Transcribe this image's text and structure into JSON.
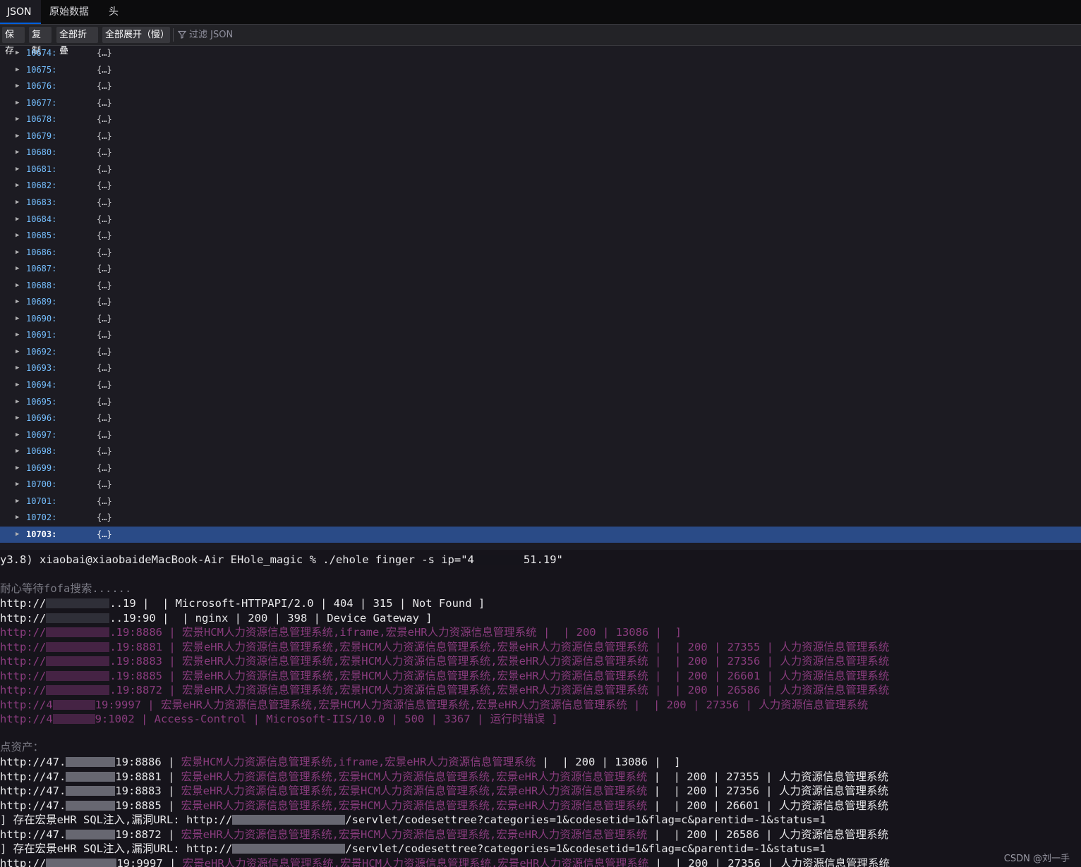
{
  "tabs": [
    {
      "label": "JSON",
      "active": true
    },
    {
      "label": "原始数据",
      "active": false
    },
    {
      "label": "头",
      "active": false
    }
  ],
  "toolbar": {
    "save_label": "保存",
    "copy_label": "复制",
    "collapse_label": "全部折叠",
    "expand_label": "全部展开（慢）",
    "filter_placeholder": "过滤 JSON"
  },
  "json_rows": [
    {
      "key": "10674:",
      "value": "{…}"
    },
    {
      "key": "10675:",
      "value": "{…}"
    },
    {
      "key": "10676:",
      "value": "{…}"
    },
    {
      "key": "10677:",
      "value": "{…}"
    },
    {
      "key": "10678:",
      "value": "{…}"
    },
    {
      "key": "10679:",
      "value": "{…}"
    },
    {
      "key": "10680:",
      "value": "{…}"
    },
    {
      "key": "10681:",
      "value": "{…}"
    },
    {
      "key": "10682:",
      "value": "{…}"
    },
    {
      "key": "10683:",
      "value": "{…}"
    },
    {
      "key": "10684:",
      "value": "{…}"
    },
    {
      "key": "10685:",
      "value": "{…}"
    },
    {
      "key": "10686:",
      "value": "{…}"
    },
    {
      "key": "10687:",
      "value": "{…}"
    },
    {
      "key": "10688:",
      "value": "{…}"
    },
    {
      "key": "10689:",
      "value": "{…}"
    },
    {
      "key": "10690:",
      "value": "{…}"
    },
    {
      "key": "10691:",
      "value": "{…}"
    },
    {
      "key": "10692:",
      "value": "{…}"
    },
    {
      "key": "10693:",
      "value": "{…}"
    },
    {
      "key": "10694:",
      "value": "{…}"
    },
    {
      "key": "10695:",
      "value": "{…}"
    },
    {
      "key": "10696:",
      "value": "{…}"
    },
    {
      "key": "10697:",
      "value": "{…}"
    },
    {
      "key": "10698:",
      "value": "{…}"
    },
    {
      "key": "10699:",
      "value": "{…}"
    },
    {
      "key": "10700:",
      "value": "{…}"
    },
    {
      "key": "10701:",
      "value": "{…}"
    },
    {
      "key": "10702:",
      "value": "{…}"
    },
    {
      "key": "10703:",
      "value": "{…}",
      "selected": true
    }
  ],
  "terminal": {
    "prompt": "y3.8) xiaobai@xiaobaideMacBook-Air EHole_magic % ./ehole finger -s ip=\"4",
    "prompt_end": "51.19\"",
    "wait_msg": "耐心等待fofa搜索......",
    "lines1": [
      {
        "pre": "http://",
        "suf": "..19 |  | Microsoft-HTTPAPI/2.0 | 404 | 315 | Not Found ]",
        "style": "white"
      },
      {
        "pre": "http://",
        "suf": "..19:90 |  | nginx | 200 | 398 | Device Gateway ]",
        "style": "white"
      },
      {
        "pre": "http://",
        "suf": ".19:8886 | 宏景HCM人力资源信息管理系统,iframe,宏景eHR人力资源信息管理系统 |  | 200 | 13086 |  ]",
        "style": "pink"
      },
      {
        "pre": "http://",
        "suf": ".19:8881 | 宏景eHR人力资源信息管理系统,宏景HCM人力资源信息管理系统,宏景eHR人力资源信息管理系统 |  | 200 | 27355 | 人力资源信息管理系统",
        "style": "pink"
      },
      {
        "pre": "http://",
        "suf": ".19:8883 | 宏景eHR人力资源信息管理系统,宏景HCM人力资源信息管理系统,宏景eHR人力资源信息管理系统 |  | 200 | 27356 | 人力资源信息管理系统",
        "style": "pink"
      },
      {
        "pre": "http://",
        "suf": ".19:8885 | 宏景eHR人力资源信息管理系统,宏景HCM人力资源信息管理系统,宏景eHR人力资源信息管理系统 |  | 200 | 26601 | 人力资源信息管理系统",
        "style": "pink"
      },
      {
        "pre": "http://",
        "suf": ".19:8872 | 宏景eHR人力资源信息管理系统,宏景HCM人力资源信息管理系统,宏景eHR人力资源信息管理系统 |  | 200 | 26586 | 人力资源信息管理系统",
        "style": "pink"
      },
      {
        "pre": "http://4",
        "suf": "19:9997 | 宏景eHR人力资源信息管理系统,宏景HCM人力资源信息管理系统,宏景eHR人力资源信息管理系统 |  | 200 | 27356 | 人力资源信息管理系统",
        "style": "pink"
      },
      {
        "pre": "http://4",
        "suf": "9:1002 | Access-Control | Microsoft-IIS/10.0 | 500 | 3367 | 运行时错误 ]",
        "style": "pink"
      }
    ],
    "key_assets": "点资产：",
    "lines2": [
      {
        "pre": "http://47.",
        "mid": "19:8886 | ",
        "pink": "宏景HCM人力资源信息管理系统,iframe,宏景eHR人力资源信息管理系统",
        "tail": " |  | 200 | 13086 |  ]",
        "kind": "asset"
      },
      {
        "pre": "http://47.",
        "mid": "19:8881 | ",
        "pink": "宏景eHR人力资源信息管理系统,宏景HCM人力资源信息管理系统,宏景eHR人力资源信息管理系统",
        "tail": " |  | 200 | 27355 | 人力资源信息管理系统",
        "kind": "asset"
      },
      {
        "pre": "http://47.",
        "mid": "19:8883 | ",
        "pink": "宏景eHR人力资源信息管理系统,宏景HCM人力资源信息管理系统,宏景eHR人力资源信息管理系统",
        "tail": " |  | 200 | 27356 | 人力资源信息管理系统",
        "kind": "asset"
      },
      {
        "pre": "http://47.",
        "mid": "19:8885 | ",
        "pink": "宏景eHR人力资源信息管理系统,宏景HCM人力资源信息管理系统,宏景eHR人力资源信息管理系统",
        "tail": " |  | 200 | 26601 | 人力资源信息管理系统",
        "kind": "asset"
      },
      {
        "pre": "] 存在宏景eHR SQL注入,漏洞URL: http://",
        "mid": "",
        "pink": "",
        "tail": "/servlet/codesettree?categories=1&codesetid=1&flag=c&parentid=-1&status=1",
        "kind": "vuln"
      },
      {
        "pre": "http://47.",
        "mid": "19:8872 | ",
        "pink": "宏景eHR人力资源信息管理系统,宏景HCM人力资源信息管理系统,宏景eHR人力资源信息管理系统",
        "tail": " |  | 200 | 26586 | 人力资源信息管理系统",
        "kind": "asset"
      },
      {
        "pre": "] 存在宏景eHR SQL注入,漏洞URL: http://",
        "mid": "",
        "pink": "",
        "tail": "/servlet/codesettree?categories=1&codesetid=1&flag=c&parentid=-1&status=1",
        "kind": "vuln"
      },
      {
        "pre": "http://",
        "mid": "19:9997 | ",
        "pink": "宏景eHR人力资源信息管理系统,宏景HCM人力资源信息管理系统,宏景eHR人力资源信息管理系统",
        "tail": " |  | 200 | 27356 | 人力资源信息管理系统",
        "kind": "asset"
      }
    ],
    "watermark": "CSDN @刘一手"
  },
  "colors": {
    "accent": "#0060df",
    "selected_row": "#2a4b87",
    "json_key": "#75bfff",
    "terminal_pink": "#8a3c7e"
  }
}
